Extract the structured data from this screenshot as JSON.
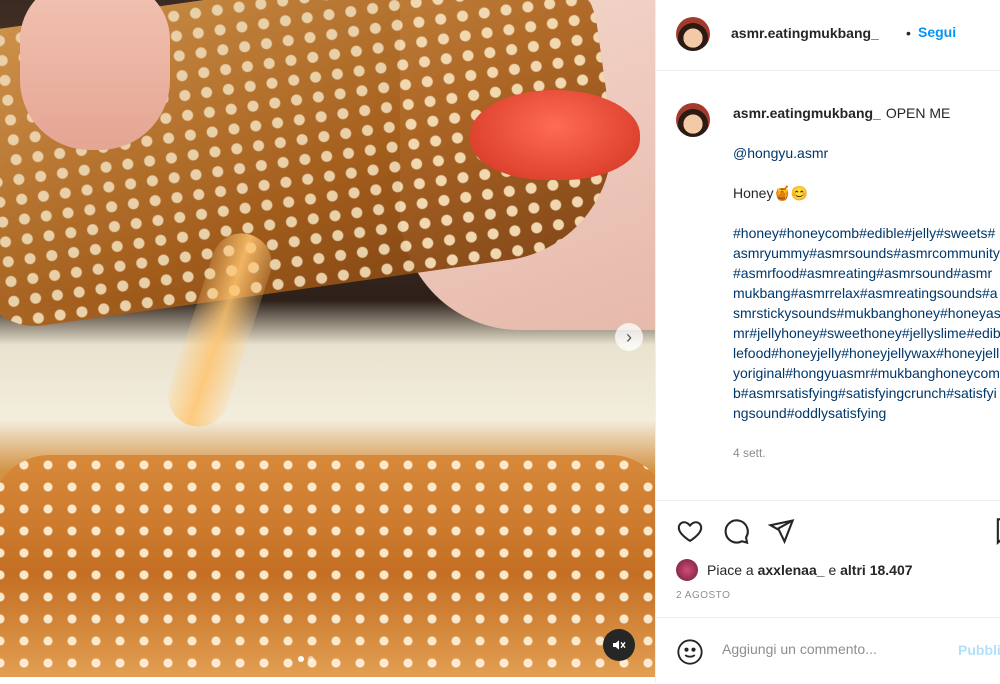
{
  "post": {
    "username": "asmr.eatingmukbang_",
    "separator": "•",
    "follow_label": "Segui",
    "caption": {
      "username": "asmr.eatingmukbang_",
      "title": "OPEN ME",
      "mention": "@hongyu.asmr",
      "line": "Honey🍯😊",
      "hashtags": "#honey#honeycomb#edible#jelly#sweets#asmryummy#asmrsounds#asmrcommunity#asmrfood#asmreating#asmrsound#asmrmukbang#asmrrelax#asmreatingsounds#asmrstickysounds#mukbanghoney#honeyasmr#jellyhoney#sweethoney#jellyslime#ediblefood#honeyjelly#honeyjellywax#honeyjellyoriginal#hongyuasmr#mukbanghoneycomb#asmrsatisfying#satisfyingcrunch#satisfyingsound#oddlysatisfying",
      "time_ago": "4 sett."
    },
    "likes": {
      "prefix": "Piace a",
      "user": "axxlenaa_",
      "middle": "e",
      "others": "altri 18.407"
    },
    "date": "2 AGOSTO",
    "comment": {
      "placeholder": "Aggiungi un commento...",
      "publish_label": "Pubblica"
    }
  },
  "media": {
    "carousel_dots": 2,
    "active_dot": 0,
    "icons": [
      "chevron-right-icon",
      "mute-icon"
    ]
  },
  "icons": {
    "like": "heart-icon",
    "comment": "comment-icon",
    "share": "send-icon",
    "save": "bookmark-icon",
    "emoji": "emoji-icon"
  },
  "colors": {
    "link": "#0095f6",
    "hashtag": "#00376b",
    "muted": "#8e8e8e"
  }
}
